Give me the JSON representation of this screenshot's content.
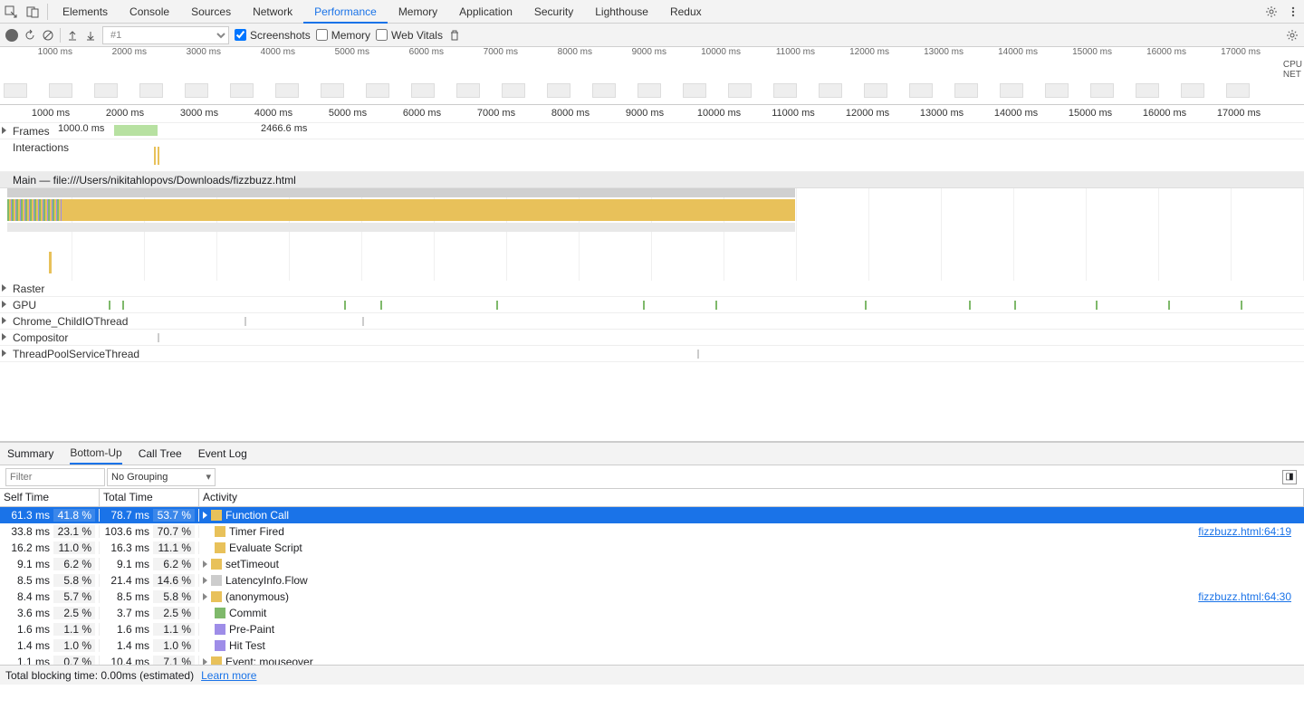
{
  "tabs": [
    "Elements",
    "Console",
    "Sources",
    "Network",
    "Performance",
    "Memory",
    "Application",
    "Security",
    "Lighthouse",
    "Redux"
  ],
  "active_tab": "Performance",
  "subbar": {
    "select_placeholder": "#1",
    "screenshots": "Screenshots",
    "memory": "Memory",
    "webvitals": "Web Vitals"
  },
  "overview": {
    "ticks": [
      "1000 ms",
      "2000 ms",
      "3000 ms",
      "4000 ms",
      "5000 ms",
      "6000 ms",
      "7000 ms",
      "8000 ms",
      "9000 ms",
      "10000 ms",
      "11000 ms",
      "12000 ms",
      "13000 ms",
      "14000 ms",
      "15000 ms",
      "16000 ms",
      "17000 ms"
    ],
    "cpu": "CPU",
    "net": "NET"
  },
  "ruler2_ticks": [
    "1000 ms",
    "2000 ms",
    "3000 ms",
    "4000 ms",
    "5000 ms",
    "6000 ms",
    "7000 ms",
    "8000 ms",
    "9000 ms",
    "10000 ms",
    "11000 ms",
    "12000 ms",
    "13000 ms",
    "14000 ms",
    "15000 ms",
    "16000 ms",
    "17000 ms",
    "1"
  ],
  "tracks": {
    "frames": "Frames",
    "frames_value": "1000.0 ms",
    "frames_value2": "2466.6 ms",
    "interactions": "Interactions",
    "main": "Main — file:///Users/nikitahlopovs/Downloads/fizzbuzz.html",
    "raster": "Raster",
    "gpu": "GPU",
    "child": "Chrome_ChildIOThread",
    "compositor": "Compositor",
    "threadpool": "ThreadPoolServiceThread"
  },
  "bottom_tabs": [
    "Summary",
    "Bottom-Up",
    "Call Tree",
    "Event Log"
  ],
  "active_bottom_tab": "Bottom-Up",
  "filter_placeholder": "Filter",
  "grouping": "No Grouping",
  "columns": {
    "self": "Self Time",
    "total": "Total Time",
    "activity": "Activity"
  },
  "rows": [
    {
      "self_ms": "61.3 ms",
      "self_pct": "41.8 %",
      "total_ms": "78.7 ms",
      "total_pct": "53.7 %",
      "act": "Function Call",
      "color": "#e8c15a",
      "arrow": true,
      "selected": true
    },
    {
      "self_ms": "33.8 ms",
      "self_pct": "23.1 %",
      "total_ms": "103.6 ms",
      "total_pct": "70.7 %",
      "act": "Timer Fired",
      "color": "#e8c15a",
      "arrow": false,
      "link": "fizzbuzz.html:64:19"
    },
    {
      "self_ms": "16.2 ms",
      "self_pct": "11.0 %",
      "total_ms": "16.3 ms",
      "total_pct": "11.1 %",
      "act": "Evaluate Script",
      "color": "#e8c15a",
      "arrow": false
    },
    {
      "self_ms": "9.1 ms",
      "self_pct": "6.2 %",
      "total_ms": "9.1 ms",
      "total_pct": "6.2 %",
      "act": "setTimeout",
      "color": "#e8c15a",
      "arrow": true
    },
    {
      "self_ms": "8.5 ms",
      "self_pct": "5.8 %",
      "total_ms": "21.4 ms",
      "total_pct": "14.6 %",
      "act": "LatencyInfo.Flow",
      "color": "#ccc",
      "arrow": true
    },
    {
      "self_ms": "8.4 ms",
      "self_pct": "5.7 %",
      "total_ms": "8.5 ms",
      "total_pct": "5.8 %",
      "act": "(anonymous)",
      "color": "#e8c15a",
      "arrow": true,
      "link": "fizzbuzz.html:64:30"
    },
    {
      "self_ms": "3.6 ms",
      "self_pct": "2.5 %",
      "total_ms": "3.7 ms",
      "total_pct": "2.5 %",
      "act": "Commit",
      "color": "#7fb96b",
      "arrow": false
    },
    {
      "self_ms": "1.6 ms",
      "self_pct": "1.1 %",
      "total_ms": "1.6 ms",
      "total_pct": "1.1 %",
      "act": "Pre-Paint",
      "color": "#9e8de8",
      "arrow": false
    },
    {
      "self_ms": "1.4 ms",
      "self_pct": "1.0 %",
      "total_ms": "1.4 ms",
      "total_pct": "1.0 %",
      "act": "Hit Test",
      "color": "#9e8de8",
      "arrow": false
    },
    {
      "self_ms": "1.1 ms",
      "self_pct": "0.7 %",
      "total_ms": "10.4 ms",
      "total_pct": "7.1 %",
      "act": "Event: mouseover",
      "color": "#e8c15a",
      "arrow": true
    }
  ],
  "statusbar": {
    "text": "Total blocking time: 0.00ms (estimated)",
    "link": "Learn more"
  }
}
